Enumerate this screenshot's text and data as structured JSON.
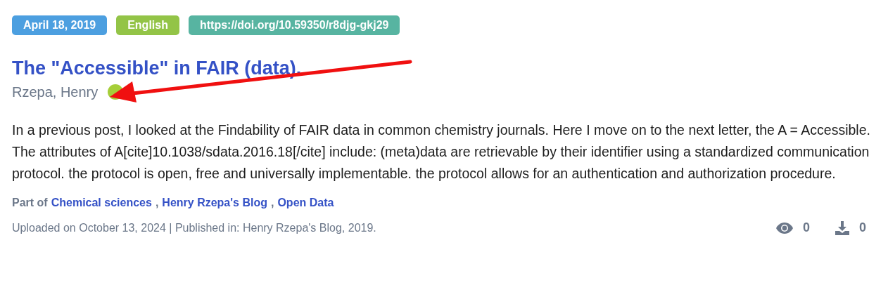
{
  "badges": [
    {
      "text": "April 18, 2019",
      "color": "#4c9fe0"
    },
    {
      "text": "English",
      "color": "#93c447"
    },
    {
      "text": "https://doi.org/10.59350/r8djg-gkj29",
      "color": "#57b4a1"
    }
  ],
  "title": "The \"Accessible\" in FAIR (data).",
  "author": "Rzepa, Henry",
  "description": "In a previous post, I looked at the Findability of FAIR data in common chemistry journals. Here I move on to the next letter, the A = Accessible. The attributes of A[cite]10.1038/sdata.2016.18[/cite] include: (meta)data are retrievable by their identifier using a standardized communication protocol. the protocol is open, free and universally implementable.  the protocol allows for an authentication and authorization procedure.",
  "part_of": {
    "label": "Part of",
    "separator": ",",
    "links": [
      "Chemical sciences",
      "Henry Rzepa's Blog",
      "Open Data"
    ]
  },
  "footer": "Uploaded on October 13, 2024 | Published in: Henry Rzepa's Blog, 2019.",
  "stats": [
    {
      "kind": "views",
      "count": "0"
    },
    {
      "kind": "downloads",
      "count": "0"
    }
  ]
}
